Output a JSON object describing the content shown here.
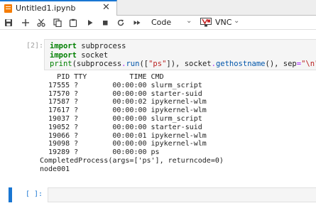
{
  "tab": {
    "title": "Untitled1.ipynb",
    "close": "✕"
  },
  "toolbar": {
    "cell_type": "Code",
    "kernel_label": "VNC",
    "icons": [
      "save-icon",
      "add-icon",
      "cut-icon",
      "copy-icon",
      "paste-icon",
      "run-icon",
      "stop-icon",
      "restart-icon",
      "fast-forward-icon"
    ]
  },
  "cell1": {
    "prompt": "[2]:",
    "code": {
      "l1_kw": "import",
      "l1_rest": " subprocess",
      "l2_kw": "import",
      "l2_rest": " socket",
      "l3_print": "print",
      "l3_a": "(subprocess",
      "l3_dot1": ".",
      "l3_run": "run",
      "l3_b": "([",
      "l3_ps": "\"ps\"",
      "l3_c": "]), socket",
      "l3_dot2": ".",
      "l3_gh": "gethostname",
      "l3_d": "(), sep",
      "l3_eq": "=",
      "l3_nl": "\"\\n\"",
      "l3_e": ")"
    },
    "output_lines": [
      "    PID TTY          TIME CMD",
      "  17555 ?        00:00:00 slurm_script",
      "  17570 ?        00:00:00 starter-suid",
      "  17587 ?        00:00:02 ipykernel-wlm",
      "  17617 ?        00:00:00 ipykernel-wlm",
      "  19037 ?        00:00:00 slurm_script",
      "  19052 ?        00:00:00 starter-suid",
      "  19066 ?        00:00:01 ipykernel-wlm",
      "  19098 ?        00:00:00 ipykernel-wlm",
      "  19289 ?        00:00:00 ps",
      "CompletedProcess(args=['ps'], returncode=0)",
      "node001"
    ]
  },
  "cell2": {
    "prompt": "[ ]:"
  },
  "colors": {
    "accent": "#1976d2",
    "kernel_icon": "#c62828",
    "notebook_icon": "#f57c00"
  }
}
